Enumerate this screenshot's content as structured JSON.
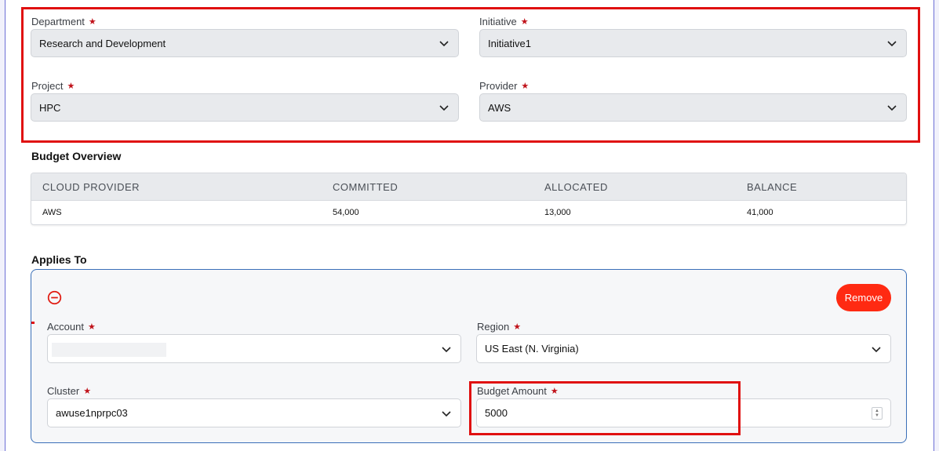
{
  "filters": {
    "department": {
      "label": "Department",
      "value": "Research and Development"
    },
    "initiative": {
      "label": "Initiative",
      "value": "Initiative1"
    },
    "project": {
      "label": "Project",
      "value": "HPC"
    },
    "provider": {
      "label": "Provider",
      "value": "AWS"
    }
  },
  "required_mark": "★",
  "budget_overview": {
    "title": "Budget Overview",
    "columns": [
      "CLOUD PROVIDER",
      "COMMITTED",
      "ALLOCATED",
      "BALANCE"
    ],
    "rows": [
      [
        "AWS",
        "54,000",
        "13,000",
        "41,000"
      ]
    ]
  },
  "applies_to": {
    "title": "Applies To",
    "remove_label": "Remove",
    "remove_icon": "minus-circle-icon",
    "account": {
      "label": "Account",
      "value": ""
    },
    "region": {
      "label": "Region",
      "value": "US East (N. Virginia)"
    },
    "cluster": {
      "label": "Cluster",
      "value": "awuse1nprpc03"
    },
    "budget_amount": {
      "label": "Budget Amount",
      "value": "5000"
    }
  },
  "colors": {
    "highlight": "#e01010",
    "remove_button": "#ff2a12",
    "card_border": "#3a6fb8",
    "required": "#c0121a"
  }
}
